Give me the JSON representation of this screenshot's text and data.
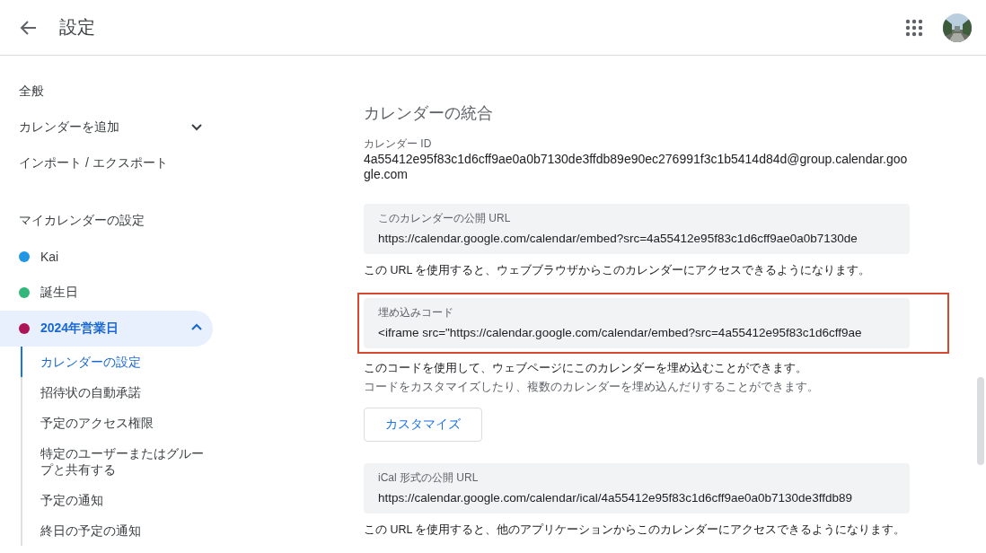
{
  "header": {
    "title": "設定"
  },
  "sidebar": {
    "items": [
      {
        "label": "全般",
        "kind": "link"
      },
      {
        "label": "カレンダーを追加",
        "kind": "collapsible",
        "expanded": false
      },
      {
        "label": "インポート / エクスポート",
        "kind": "link"
      }
    ],
    "section_title": "マイカレンダーの設定",
    "calendars": [
      {
        "label": "Kai",
        "color": "#2196e3",
        "selected": false,
        "expanded": false
      },
      {
        "label": "誕生日",
        "color": "#33b679",
        "selected": false,
        "expanded": false
      },
      {
        "label": "2024年営業日",
        "color": "#ad1457",
        "selected": true,
        "expanded": true,
        "children": [
          {
            "label": "カレンダーの設定",
            "selected": true
          },
          {
            "label": "招待状の自動承諾",
            "selected": false
          },
          {
            "label": "予定のアクセス権限",
            "selected": false
          },
          {
            "label": "特定のユーザーまたはグループと共有する",
            "selected": false
          },
          {
            "label": "予定の通知",
            "selected": false
          },
          {
            "label": "終日の予定の通知",
            "selected": false
          }
        ]
      }
    ]
  },
  "content": {
    "title": "カレンダーの統合",
    "calendar_id": {
      "label": "カレンダー ID",
      "value": "4a55412e95f83c1d6cff9ae0a0b7130de3ffdb89e90ec276991f3c1b5414d84d@group.calendar.google.com"
    },
    "blocks": [
      {
        "kind": "field",
        "label": "このカレンダーの公開 URL",
        "value": "https://calendar.google.com/calendar/embed?src=4a55412e95f83c1d6cff9ae0a0b7130de",
        "highlighted": false,
        "notes": [
          "この URL を使用すると、ウェブブラウザからこのカレンダーにアクセスできるようになります。"
        ]
      },
      {
        "kind": "field",
        "label": "埋め込みコード",
        "value": "<iframe src=\"https://calendar.google.com/calendar/embed?src=4a55412e95f83c1d6cff9ae",
        "highlighted": true,
        "notes": [
          "このコードを使用して、ウェブページにこのカレンダーを埋め込むことができます。",
          "コードをカスタマイズしたり、複数のカレンダーを埋め込んだりすることができます。"
        ],
        "button": "カスタマイズ"
      },
      {
        "kind": "field",
        "label": "iCal 形式の公開 URL",
        "value": "https://calendar.google.com/calendar/ical/4a55412e95f83c1d6cff9ae0a0b7130de3ffdb89",
        "highlighted": false,
        "notes": [
          "この URL を使用すると、他のアプリケーションからこのカレンダーにアクセスできるようになります。"
        ]
      }
    ]
  }
}
